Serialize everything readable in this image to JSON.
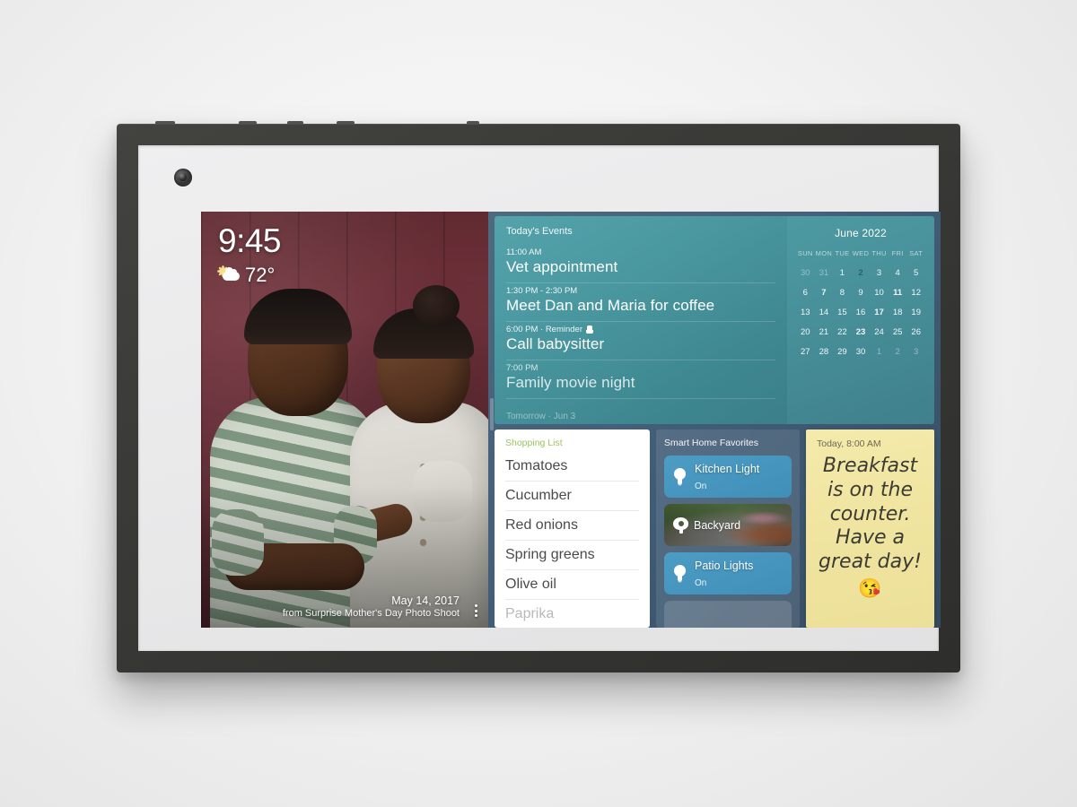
{
  "device": {
    "name": "smart-display",
    "camera_icon": "camera-lens-icon"
  },
  "photo": {
    "clock": "9:45",
    "weather_icon": "sun-behind-cloud-icon",
    "temperature": "72°",
    "caption_date": "May 14, 2017",
    "caption_album": "from Surprise Mother's Day Photo Shoot",
    "menu_icon": "more-options-vertical-icon"
  },
  "events": {
    "title": "Today's Events",
    "next_label": "Tomorrow · Jun 3",
    "items": [
      {
        "time": "11:00 AM",
        "title": "Vet appointment",
        "icon": ""
      },
      {
        "time": "1:30 PM - 2:30 PM",
        "title": "Meet Dan and Maria for coffee",
        "icon": ""
      },
      {
        "time": "6:00 PM · Reminder",
        "title": "Call babysitter",
        "icon": "reminder-icon"
      },
      {
        "time": "7:00 PM",
        "title": "Family movie night",
        "icon": ""
      }
    ]
  },
  "calendar": {
    "month": "June 2022",
    "dow": [
      "SUN",
      "MON",
      "TUE",
      "WED",
      "THU",
      "FRI",
      "SAT"
    ],
    "today": 2,
    "weeks": [
      [
        {
          "d": "30",
          "dim": true
        },
        {
          "d": "31",
          "dim": true
        },
        {
          "d": "1"
        },
        {
          "d": "2",
          "today": true
        },
        {
          "d": "3"
        },
        {
          "d": "4"
        },
        {
          "d": "5"
        }
      ],
      [
        {
          "d": "6"
        },
        {
          "d": "7",
          "bold": true
        },
        {
          "d": "8"
        },
        {
          "d": "9"
        },
        {
          "d": "10"
        },
        {
          "d": "11",
          "bold": true
        },
        {
          "d": "12"
        }
      ],
      [
        {
          "d": "13"
        },
        {
          "d": "14"
        },
        {
          "d": "15"
        },
        {
          "d": "16"
        },
        {
          "d": "17",
          "bold": true
        },
        {
          "d": "18"
        },
        {
          "d": "19"
        }
      ],
      [
        {
          "d": "20"
        },
        {
          "d": "21"
        },
        {
          "d": "22"
        },
        {
          "d": "23",
          "bold": true
        },
        {
          "d": "24"
        },
        {
          "d": "25"
        },
        {
          "d": "26"
        }
      ],
      [
        {
          "d": "27"
        },
        {
          "d": "28"
        },
        {
          "d": "29"
        },
        {
          "d": "30"
        },
        {
          "d": "1",
          "dim": true
        },
        {
          "d": "2",
          "dim": true
        },
        {
          "d": "3",
          "dim": true
        }
      ]
    ]
  },
  "shopping": {
    "title": "Shopping List",
    "title_color": "#9cc45e",
    "items": [
      {
        "label": "Tomatoes",
        "faded": false
      },
      {
        "label": "Cucumber",
        "faded": false
      },
      {
        "label": "Red onions",
        "faded": false
      },
      {
        "label": "Spring greens",
        "faded": false
      },
      {
        "label": "Olive oil",
        "faded": false
      },
      {
        "label": "Paprika",
        "faded": true
      }
    ]
  },
  "smart_home": {
    "title": "Smart Home Favorites",
    "tiles": [
      {
        "name": "Kitchen Light",
        "state": "On",
        "icon": "lightbulb-icon",
        "kind": "light"
      },
      {
        "name": "Backyard",
        "state": "",
        "icon": "security-camera-icon",
        "kind": "cam"
      },
      {
        "name": "Patio Lights",
        "state": "On",
        "icon": "lightbulb-icon",
        "kind": "light"
      }
    ]
  },
  "note": {
    "time": "Today, 8:00 AM",
    "body": "Breakfast\nis on the\ncounter.\nHave a\ngreat day!",
    "emoji": "😘"
  }
}
